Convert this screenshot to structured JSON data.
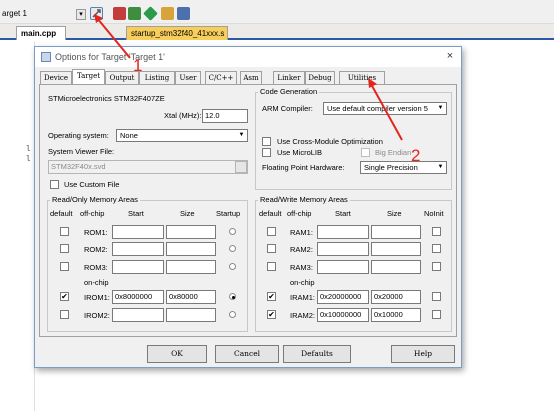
{
  "ide": {
    "target_label": "arget 1",
    "file_tabs": [
      "main.cpp",
      "startup_stm32f40_41xxx.s"
    ],
    "gutter_marks": [
      "l",
      "l"
    ]
  },
  "dialog": {
    "title": "Options for Target 'Target 1'",
    "close": "×",
    "tabs": [
      "Device",
      "Target",
      "Output",
      "Listing",
      "User",
      "C/C++",
      "Asm",
      "Linker",
      "Debug",
      "Utilities"
    ],
    "active_tab": "Target",
    "device_name": "STMicroelectronics STM32F407ZE",
    "xtal_label": "Xtal (MHz):",
    "xtal_value": "12.0",
    "os_label": "Operating system:",
    "os_value": "None",
    "svf_label": "System Viewer File:",
    "svf_value": "STM32F40x.svd",
    "custom_file_label": "Use Custom File",
    "codegen": {
      "title": "Code Generation",
      "compiler_label": "ARM Compiler:",
      "compiler_value": "Use default compiler version 5",
      "cross_module": "Use Cross-Module Optimization",
      "microlib": "Use MicroLIB",
      "big_endian": "Big Endian",
      "fp_label": "Floating Point Hardware:",
      "fp_value": "Single Precision"
    },
    "rom": {
      "title": "Read/Only Memory Areas",
      "headers": [
        "default",
        "off-chip",
        "Start",
        "Size",
        "Startup"
      ],
      "offchip_rows": [
        "ROM1:",
        "ROM2:",
        "ROM3:"
      ],
      "onchip_label": "on-chip",
      "irom1": {
        "label": "IROM1:",
        "start": "0x8000000",
        "size": "0x80000"
      },
      "irom2": {
        "label": "IROM2:",
        "start": "",
        "size": ""
      }
    },
    "ram": {
      "title": "Read/Write Memory Areas",
      "headers": [
        "default",
        "off-chip",
        "Start",
        "Size",
        "NoInit"
      ],
      "offchip_rows": [
        "RAM1:",
        "RAM2:",
        "RAM3:"
      ],
      "onchip_label": "on-chip",
      "iram1": {
        "label": "IRAM1:",
        "start": "0x20000000",
        "size": "0x20000"
      },
      "iram2": {
        "label": "IRAM2:",
        "start": "0x10000000",
        "size": "0x10000"
      }
    },
    "buttons": {
      "ok": "OK",
      "cancel": "Cancel",
      "defaults": "Defaults",
      "help": "Help"
    }
  },
  "annotations": {
    "step1": "1",
    "step2": "2",
    "color": "#e2261d"
  }
}
